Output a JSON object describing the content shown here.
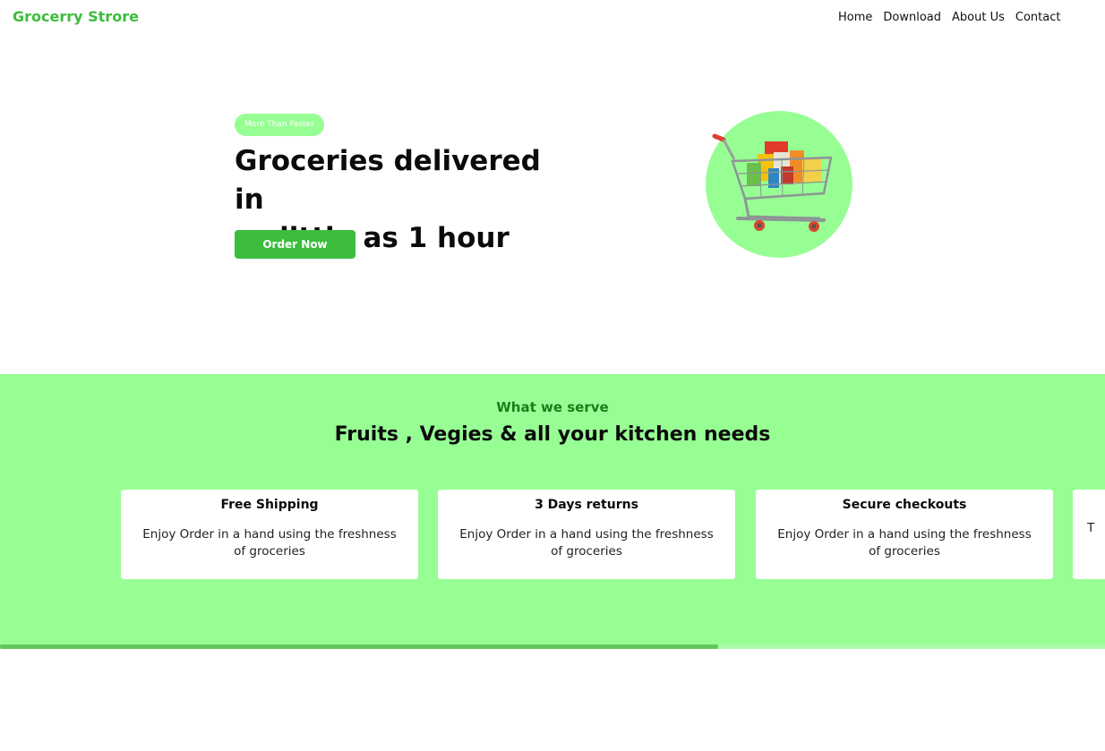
{
  "header": {
    "brand": "Grocerry Strore",
    "menu": [
      "Home",
      "Download",
      "About Us",
      "Contact"
    ]
  },
  "hero": {
    "badge": "More Than Faster",
    "title_line1": "Groceries delivered in",
    "title_line2": "as little as 1 hour",
    "cta": "Order Now",
    "image_icon": "shopping-cart-icon"
  },
  "serve": {
    "subtitle": "What we serve",
    "title": "Fruits , Vegies & all your kitchen needs",
    "cards": [
      {
        "title": "Free Shipping",
        "text": "Enjoy Order in a hand using the freshness of groceries"
      },
      {
        "title": "3 Days returns",
        "text": "Enjoy Order in a hand using the freshness of groceries"
      },
      {
        "title": "Secure checkouts",
        "text": "Enjoy Order in a hand using the freshness of groceries"
      },
      {
        "title": "",
        "text": "T"
      }
    ]
  },
  "scrollbar": {
    "position_fraction": 0.65
  },
  "colors": {
    "brand_green": "#3cbc3c",
    "light_green": "#97fe94",
    "dark_green_text": "#1a7e1a",
    "button_green": "#3dbd3d",
    "card_bg": "#ffffff"
  }
}
